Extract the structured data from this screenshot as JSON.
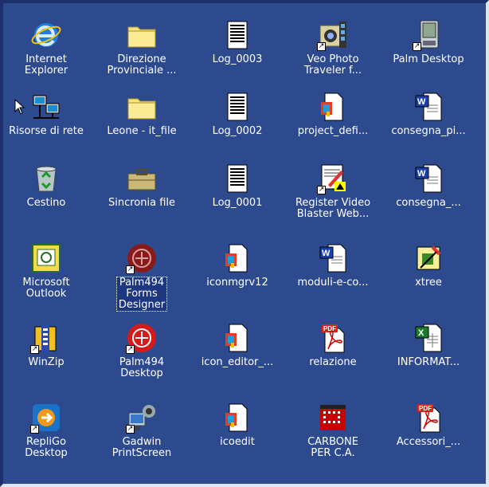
{
  "desktop": {
    "icons": [
      {
        "label": "Internet\nExplorer",
        "icon": "ie-icon",
        "shortcut": false
      },
      {
        "label": "Direzione\nProvinciale ...",
        "icon": "folder-icon",
        "shortcut": false
      },
      {
        "label": "Log_0003",
        "icon": "text-document-icon",
        "shortcut": false
      },
      {
        "label": "Veo Photo\nTraveler f...",
        "icon": "camera-app-icon",
        "shortcut": true
      },
      {
        "label": "Palm Desktop",
        "icon": "palm-device-icon",
        "shortcut": true
      },
      {
        "label": "Risorse di rete",
        "icon": "network-icon",
        "shortcut": false
      },
      {
        "label": "Leone - it_file",
        "icon": "folder-icon",
        "shortcut": false
      },
      {
        "label": "Log_0002",
        "icon": "text-document-icon",
        "shortcut": false
      },
      {
        "label": "project_defi...",
        "icon": "generic-document-icon",
        "shortcut": false
      },
      {
        "label": "consegna_pi...",
        "icon": "word-document-icon",
        "shortcut": false
      },
      {
        "label": "Cestino",
        "icon": "recycle-bin-icon",
        "shortcut": false
      },
      {
        "label": "Sincronia file",
        "icon": "briefcase-icon",
        "shortcut": false
      },
      {
        "label": "Log_0001",
        "icon": "text-document-icon",
        "shortcut": false
      },
      {
        "label": "Register Video\nBlaster Web...",
        "icon": "register-app-icon",
        "shortcut": true
      },
      {
        "label": "consegna_...",
        "icon": "word-document-icon",
        "shortcut": false
      },
      {
        "label": "Microsoft\nOutlook",
        "icon": "outlook-icon",
        "shortcut": false
      },
      {
        "label": "Palm494\nForms\nDesigner",
        "icon": "palm-forms-icon",
        "shortcut": true,
        "selected": true
      },
      {
        "label": "iconmgrv12",
        "icon": "generic-document-icon",
        "shortcut": false
      },
      {
        "label": "moduli-e-co...",
        "icon": "word-document-icon",
        "shortcut": false
      },
      {
        "label": "xtree",
        "icon": "xtree-icon",
        "shortcut": false
      },
      {
        "label": "WinZip",
        "icon": "winzip-icon",
        "shortcut": true
      },
      {
        "label": "Palm494\nDesktop",
        "icon": "palm-desktop-red-icon",
        "shortcut": true
      },
      {
        "label": "icon_editor_...",
        "icon": "generic-document-icon",
        "shortcut": false
      },
      {
        "label": "relazione",
        "icon": "pdf-icon",
        "shortcut": false
      },
      {
        "label": "INFORMAT...",
        "icon": "excel-document-icon",
        "shortcut": false
      },
      {
        "label": "RepliGo\nDesktop",
        "icon": "repligo-icon",
        "shortcut": true
      },
      {
        "label": "Gadwin\nPrintScreen",
        "icon": "gadwin-icon",
        "shortcut": true
      },
      {
        "label": "icoedit",
        "icon": "generic-document-icon",
        "shortcut": false
      },
      {
        "label": "CARBONE\nPER C.A.",
        "icon": "carbone-icon",
        "shortcut": false
      },
      {
        "label": "Accessori_...",
        "icon": "pdf-icon",
        "shortcut": false
      }
    ]
  },
  "colors": {
    "desktop_bg": "#2e4a8f",
    "label_text": "#ffffff",
    "selection_bg": "#1d3780"
  }
}
